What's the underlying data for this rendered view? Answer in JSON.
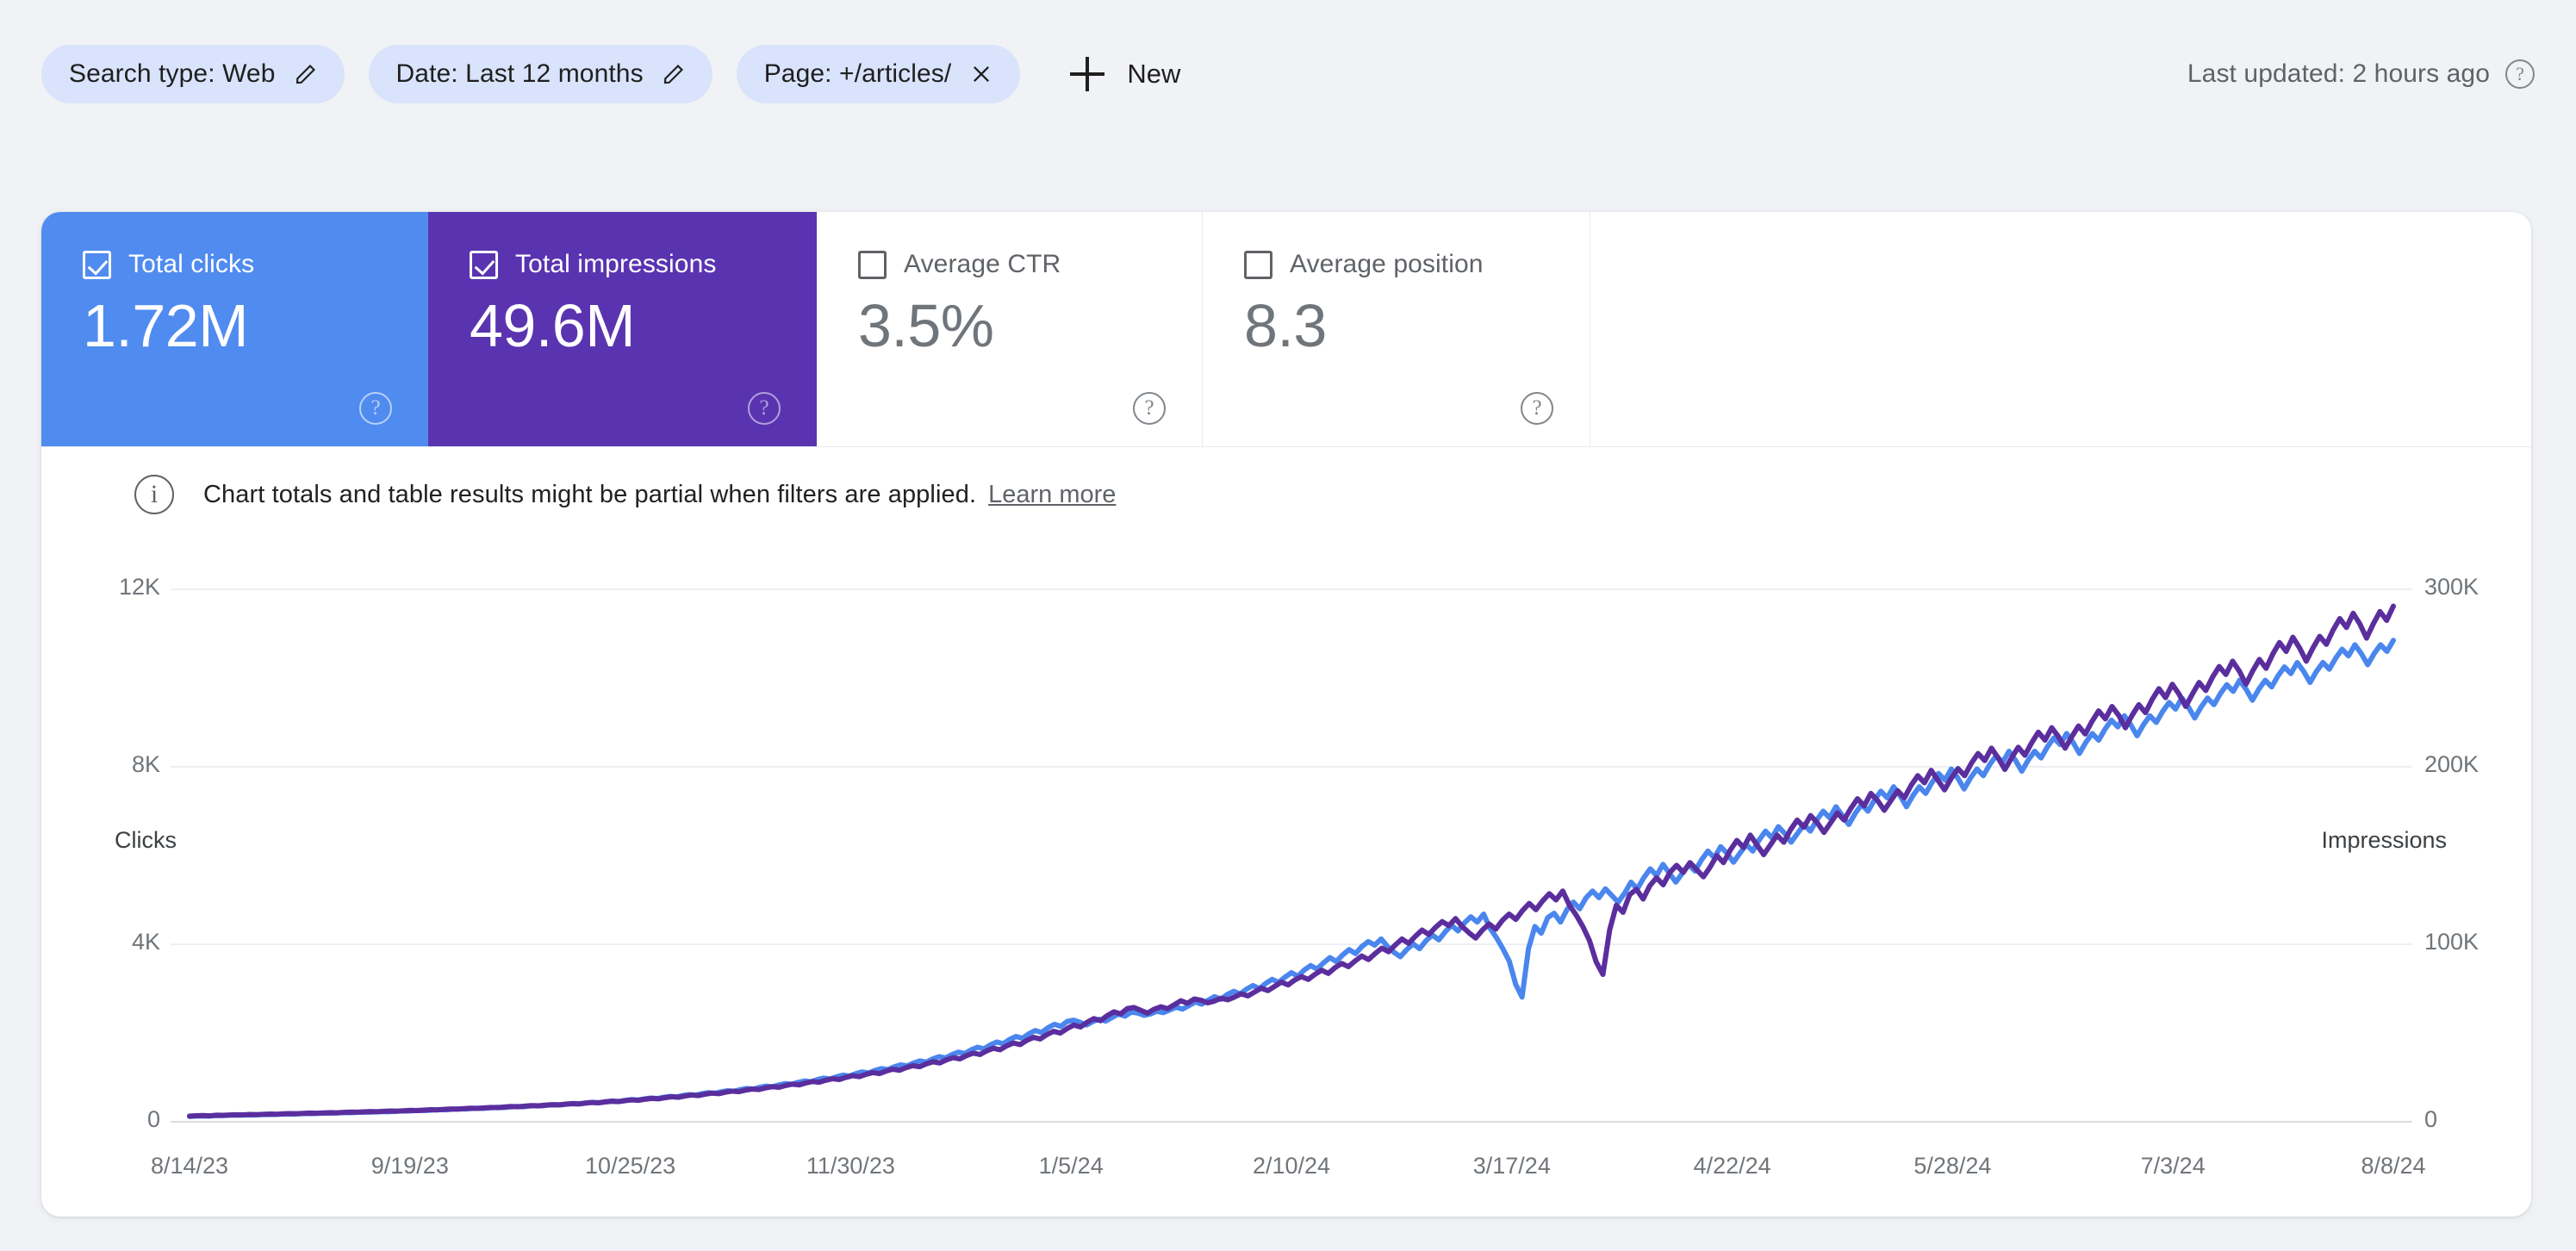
{
  "filters": {
    "chips": [
      {
        "label": "Search type: Web",
        "action": "pencil-icon",
        "action_name": "edit-icon"
      },
      {
        "label": "Date: Last 12 months",
        "action": "pencil-icon",
        "action_name": "edit-icon"
      },
      {
        "label": "Page: +/articles/",
        "action": "close-icon",
        "action_name": "close-icon"
      }
    ],
    "new_button": {
      "icon": "plus-icon",
      "label": "New"
    },
    "last_updated": "Last updated: 2 hours ago",
    "last_updated_help": "?"
  },
  "metrics": [
    {
      "name": "Total clicks",
      "value": "1.72M",
      "checked": true,
      "help": "?",
      "color": "#508bf0"
    },
    {
      "name": "Total impressions",
      "value": "49.6M",
      "checked": true,
      "help": "?",
      "color": "#5a34b0"
    },
    {
      "name": "Average CTR",
      "value": "3.5%",
      "checked": false,
      "help": "?",
      "color": "#ffffff"
    },
    {
      "name": "Average position",
      "value": "8.3",
      "checked": false,
      "help": "?",
      "color": "#ffffff"
    }
  ],
  "banner": {
    "icon": "info-icon",
    "text": "Chart totals and table results might be partial when filters are applied.",
    "link": "Learn more"
  },
  "chart_data": {
    "type": "line",
    "title": "",
    "xlabel": "",
    "ylabel": "Clicks",
    "y2label": "Impressions",
    "grid": true,
    "legend": "none",
    "ylim": [
      0,
      12000
    ],
    "y2lim": [
      0,
      300000
    ],
    "yticks": [
      0,
      4000,
      8000,
      12000
    ],
    "ytick_labels": [
      "0",
      "4K",
      "8K",
      "12K"
    ],
    "y2ticks": [
      0,
      100000,
      200000,
      300000
    ],
    "y2tick_labels": [
      "0",
      "100K",
      "200K",
      "300K"
    ],
    "xtick_labels": [
      "8/14/23",
      "9/19/23",
      "10/25/23",
      "11/30/23",
      "1/5/24",
      "2/10/24",
      "3/17/24",
      "4/22/24",
      "5/28/24",
      "7/3/24",
      "8/8/24"
    ],
    "x_start": "8/14/23",
    "x_end": "8/8/24",
    "n_points": 361,
    "series": [
      {
        "name": "Clicks",
        "color": "#4a86ed",
        "axis": "left",
        "values": [
          120,
          128,
          132,
          126,
          140,
          138,
          145,
          150,
          148,
          156,
          152,
          160,
          166,
          162,
          170,
          175,
          172,
          180,
          186,
          182,
          190,
          196,
          192,
          200,
          208,
          204,
          212,
          218,
          215,
          224,
          230,
          226,
          236,
          244,
          240,
          250,
          258,
          254,
          266,
          274,
          270,
          282,
          291,
          286,
          298,
          307,
          302,
          316,
          326,
          320,
          334,
          345,
          338,
          354,
          365,
          358,
          375,
          388,
          380,
          398,
          412,
          404,
          424,
          438,
          430,
          452,
          468,
          458,
          482,
          500,
          490,
          516,
          534,
          524,
          552,
          572,
          560,
          590,
          612,
          600,
          632,
          655,
          642,
          676,
          700,
          688,
          724,
          750,
          736,
          776,
          804,
          788,
          830,
          860,
          844,
          888,
          920,
          902,
          950,
          984,
          964,
          1014,
          1051,
          1030,
          1084,
          1123,
          1100,
          1158,
          1200,
          1176,
          1238,
          1283,
          1257,
          1324,
          1372,
          1344,
          1416,
          1467,
          1437,
          1514,
          1569,
          1537,
          1620,
          1680,
          1645,
          1733,
          1797,
          1760,
          1854,
          1922,
          1882,
          1982,
          2055,
          2012,
          2118,
          2196,
          2150,
          2262,
          2290,
          2240,
          2180,
          2260,
          2310,
          2270,
          2350,
          2430,
          2380,
          2470,
          2450,
          2400,
          2430,
          2490,
          2460,
          2520,
          2580,
          2540,
          2620,
          2700,
          2650,
          2740,
          2820,
          2760,
          2870,
          2940,
          2880,
          2990,
          3070,
          3000,
          3120,
          3210,
          3140,
          3260,
          3360,
          3280,
          3420,
          3520,
          3440,
          3580,
          3700,
          3610,
          3760,
          3880,
          3790,
          3950,
          4060,
          3980,
          4120,
          3950,
          3820,
          3720,
          3880,
          4010,
          3900,
          4080,
          4210,
          4100,
          4280,
          4430,
          4300,
          4480,
          4620,
          4500,
          4680,
          4360,
          4150,
          3900,
          3620,
          3100,
          2810,
          3900,
          4400,
          4250,
          4600,
          4700,
          4500,
          4780,
          4950,
          4800,
          5050,
          5200,
          5050,
          5250,
          5100,
          4950,
          5150,
          5400,
          5250,
          5500,
          5700,
          5550,
          5800,
          5600,
          5400,
          5600,
          5800,
          5650,
          5900,
          6100,
          5950,
          6200,
          6050,
          5850,
          6050,
          6250,
          6100,
          6350,
          6550,
          6400,
          6650,
          6500,
          6300,
          6500,
          6700,
          6550,
          6800,
          7000,
          6850,
          7100,
          6900,
          6700,
          6950,
          7150,
          7000,
          7250,
          7450,
          7300,
          7550,
          7350,
          7100,
          7350,
          7550,
          7400,
          7650,
          7850,
          7700,
          7950,
          7750,
          7500,
          7750,
          7950,
          7800,
          8050,
          8250,
          8100,
          8350,
          8150,
          7900,
          8150,
          8350,
          8200,
          8450,
          8650,
          8500,
          8750,
          8550,
          8300,
          8550,
          8750,
          8600,
          8850,
          9050,
          8900,
          9150,
          8950,
          8700,
          8950,
          9150,
          9000,
          9250,
          9450,
          9300,
          9550,
          9350,
          9100,
          9350,
          9550,
          9400,
          9650,
          9850,
          9700,
          9950,
          9750,
          9500,
          9750,
          9950,
          9800,
          10050,
          10250,
          10100,
          10350,
          10150,
          9900,
          10150,
          10350,
          10200,
          10450,
          10650,
          10500,
          10750,
          10550,
          10300,
          10550,
          10750,
          10600,
          10850
        ]
      },
      {
        "name": "Impressions",
        "color": "#5b2e9e",
        "axis": "right",
        "values": [
          3200,
          3400,
          3500,
          3350,
          3700,
          3650,
          3820,
          3950,
          3900,
          4100,
          4000,
          4200,
          4360,
          4270,
          4480,
          4600,
          4530,
          4740,
          4890,
          4800,
          5000,
          5150,
          5060,
          5270,
          5480,
          5380,
          5590,
          5740,
          5660,
          5900,
          6060,
          5960,
          6210,
          6420,
          6320,
          6580,
          6790,
          6700,
          7010,
          7220,
          7110,
          7430,
          7670,
          7540,
          7850,
          8090,
          7960,
          8330,
          8600,
          8440,
          8800,
          9090,
          8910,
          9330,
          9610,
          9440,
          9880,
          10220,
          10020,
          10480,
          10850,
          10650,
          11170,
          11540,
          11330,
          11900,
          12330,
          12080,
          12700,
          13180,
          12910,
          13590,
          14070,
          13800,
          14540,
          15070,
          14760,
          15550,
          16130,
          15810,
          16660,
          17260,
          16930,
          17820,
          18450,
          18130,
          19080,
          19770,
          19400,
          20450,
          21190,
          20780,
          21870,
          22660,
          22250,
          23400,
          24240,
          23770,
          25040,
          25930,
          25410,
          26720,
          27710,
          27150,
          28570,
          29590,
          29000,
          30510,
          31610,
          31000,
          32620,
          33800,
          33130,
          34890,
          36140,
          35430,
          37300,
          38660,
          37890,
          39940,
          41420,
          40580,
          42800,
          44380,
          43490,
          45890,
          47580,
          46640,
          49140,
          50990,
          49970,
          52510,
          54470,
          53380,
          56080,
          58110,
          56950,
          59800,
          61970,
          60750,
          63780,
          64400,
          62800,
          61200,
          63400,
          64800,
          63700,
          65900,
          68200,
          66800,
          69200,
          68500,
          67000,
          68000,
          69600,
          68700,
          70300,
          72100,
          70900,
          73100,
          75300,
          73900,
          76300,
          78700,
          77100,
          79900,
          81800,
          80200,
          83000,
          85400,
          83600,
          86800,
          89200,
          87400,
          90600,
          93400,
          91400,
          94800,
          97800,
          95800,
          99600,
          103000,
          100500,
          104500,
          108000,
          105500,
          109500,
          112800,
          110500,
          114500,
          110000,
          106500,
          103500,
          108000,
          111500,
          108500,
          113500,
          117000,
          114000,
          119000,
          123000,
          119500,
          124500,
          128500,
          125000,
          130000,
          122000,
          116500,
          110000,
          102000,
          90000,
          83000,
          108000,
          122000,
          118000,
          128000,
          131000,
          125500,
          133000,
          137500,
          133500,
          140500,
          144500,
          140500,
          146000,
          142000,
          138000,
          143500,
          150000,
          146000,
          153000,
          158500,
          154500,
          161500,
          156000,
          150500,
          156000,
          161500,
          157500,
          164500,
          170000,
          166000,
          172500,
          168500,
          163000,
          168500,
          174000,
          170000,
          176500,
          182000,
          178000,
          185000,
          181000,
          175500,
          181000,
          186500,
          182500,
          189500,
          195000,
          191000,
          198000,
          192500,
          187000,
          193500,
          199000,
          195000,
          202000,
          207500,
          203500,
          210500,
          205000,
          198500,
          205000,
          211000,
          206500,
          213500,
          219500,
          215000,
          222000,
          217000,
          210500,
          217000,
          223000,
          218500,
          225500,
          231500,
          227000,
          234000,
          229000,
          222000,
          229000,
          235000,
          230500,
          238000,
          244000,
          239000,
          246500,
          241000,
          234000,
          241000,
          247500,
          243000,
          250500,
          256500,
          252000,
          259500,
          254000,
          246500,
          254000,
          260500,
          255500,
          263500,
          270000,
          265000,
          273000,
          267000,
          259500,
          267000,
          273500,
          269000,
          277000,
          283500,
          278500,
          286500,
          280500,
          272500,
          280500,
          287500,
          282500,
          290500
        ]
      }
    ]
  }
}
